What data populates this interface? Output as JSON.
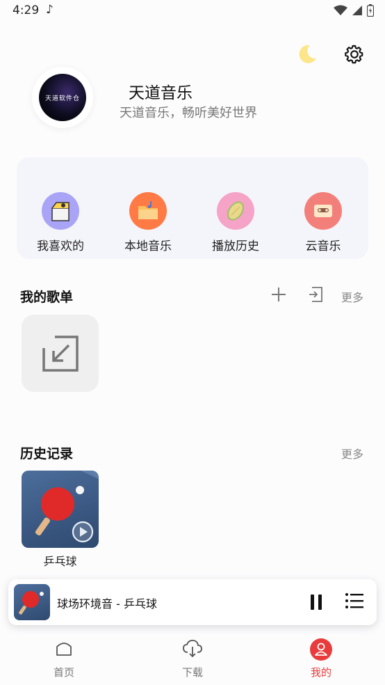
{
  "status_bar": {
    "time": "4:29"
  },
  "profile": {
    "name": "天道音乐",
    "subtitle": "天道音乐，畅听美好世界",
    "avatar_text": "天道软件仓"
  },
  "quick_actions": [
    {
      "label": "我喜欢的",
      "icon": "favorites-box-icon",
      "color": "#a9a4f5"
    },
    {
      "label": "本地音乐",
      "icon": "local-folder-icon",
      "color": "#ff7a45"
    },
    {
      "label": "播放历史",
      "icon": "history-disc-icon",
      "color": "#f5a3c6"
    },
    {
      "label": "云音乐",
      "icon": "cloud-cassette-icon",
      "color": "#f37f7a"
    }
  ],
  "playlists_section": {
    "title": "我的歌单",
    "more": "更多"
  },
  "history_section": {
    "title": "历史记录",
    "more": "更多",
    "items": [
      {
        "title": "乒乓球"
      }
    ]
  },
  "mini_player": {
    "title": "球场环境音 - 乒乓球"
  },
  "tabs": [
    {
      "label": "首页",
      "icon": "home-icon",
      "active": false
    },
    {
      "label": "下载",
      "icon": "cloud-download-icon",
      "active": false
    },
    {
      "label": "我的",
      "icon": "user-icon",
      "active": true
    }
  ],
  "colors": {
    "accent": "#e93b3b",
    "card_bg": "#f4f5fa",
    "moon": "#fde68a"
  }
}
